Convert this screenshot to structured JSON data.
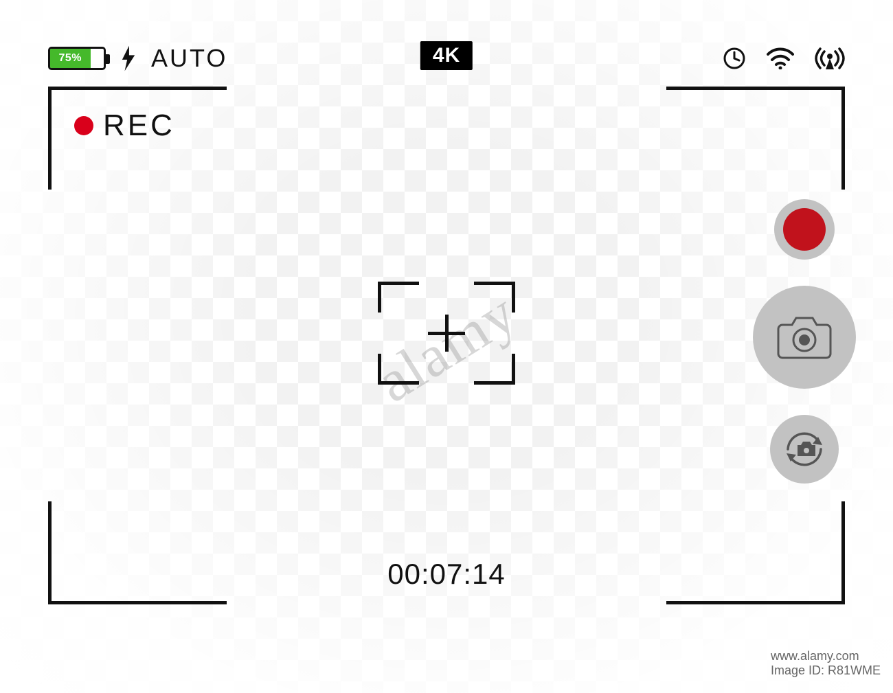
{
  "battery": {
    "percent": 75,
    "label": "75%"
  },
  "flash": {
    "mode": "AUTO"
  },
  "resolution": "4K",
  "icons": {
    "timer": "clock-icon",
    "wifi": "wifi-icon",
    "signal": "broadcast-icon"
  },
  "recording": {
    "label": "REC"
  },
  "timer": "00:07:14",
  "watermark": {
    "main": "alamy",
    "corner_site": "www.alamy.com",
    "corner_id": "Image ID: R81WME"
  },
  "buttons": {
    "record": "record-button",
    "shutter": "shutter-button",
    "switch": "switch-camera-button"
  }
}
